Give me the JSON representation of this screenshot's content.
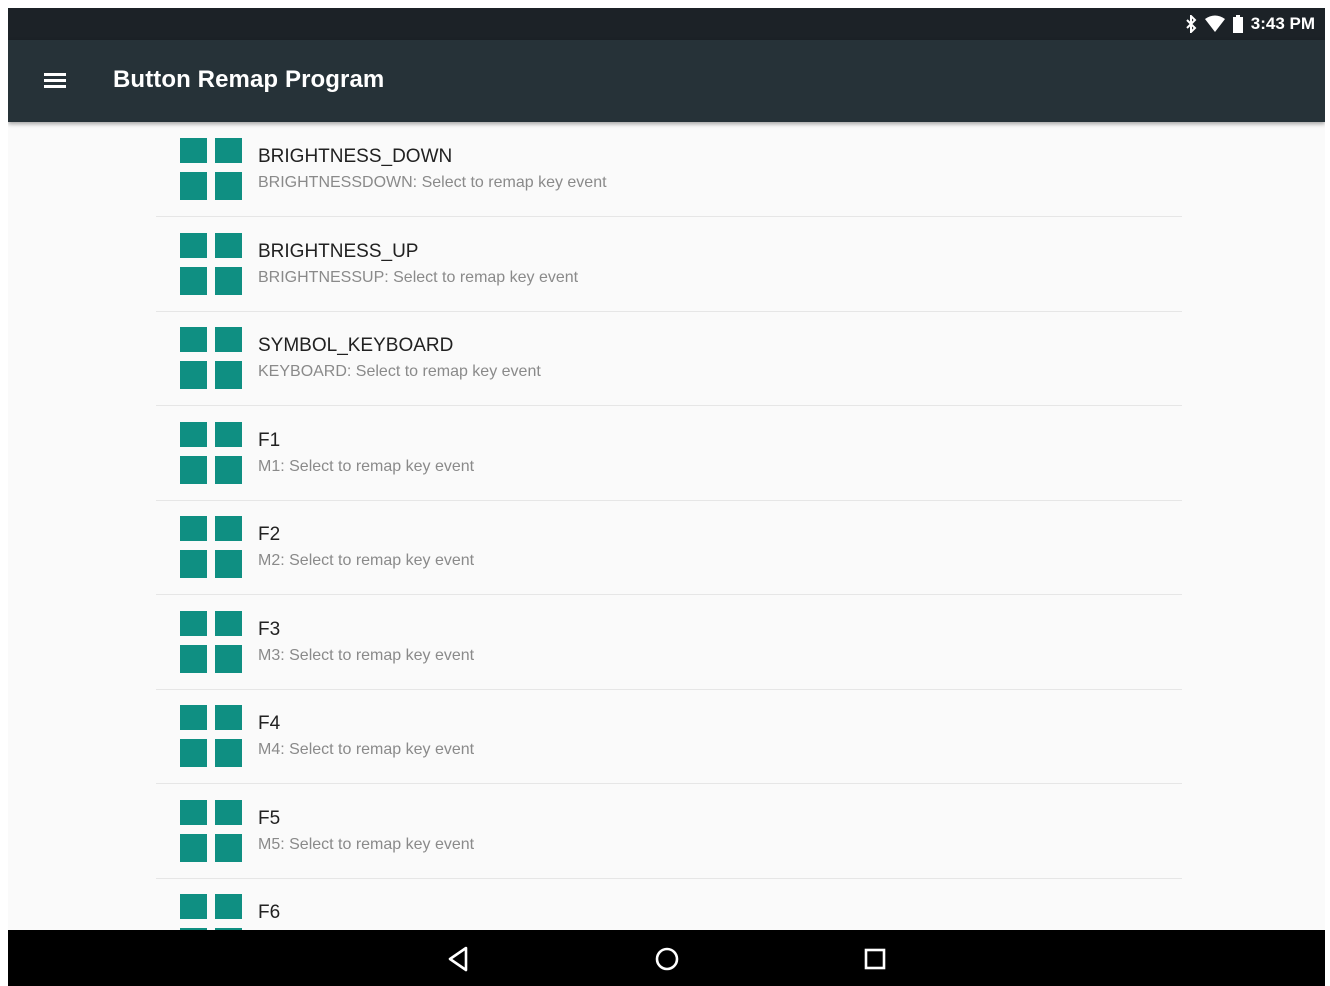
{
  "status_bar": {
    "time": "3:43 PM",
    "icons": [
      "bluetooth-icon",
      "wifi-icon",
      "battery-icon"
    ]
  },
  "app_bar": {
    "menu_icon": "hamburger-menu-icon",
    "title": "Button Remap Program"
  },
  "colors": {
    "status_bar": "#1c2227",
    "app_bar": "#263238",
    "icon_teal": "#0f8f82",
    "background": "#fafafa",
    "nav_bar": "#000000"
  },
  "list": {
    "items": [
      {
        "title": "BRIGHTNESS_DOWN",
        "subtitle": "BRIGHTNESSDOWN: Select to remap key event",
        "icon": "grid-app-icon"
      },
      {
        "title": "BRIGHTNESS_UP",
        "subtitle": "BRIGHTNESSUP: Select to remap key event",
        "icon": "grid-app-icon"
      },
      {
        "title": "SYMBOL_KEYBOARD",
        "subtitle": "KEYBOARD: Select to remap key event",
        "icon": "grid-app-icon"
      },
      {
        "title": "F1",
        "subtitle": "M1: Select to remap key event",
        "icon": "grid-app-icon"
      },
      {
        "title": "F2",
        "subtitle": "M2: Select to remap key event",
        "icon": "grid-app-icon"
      },
      {
        "title": "F3",
        "subtitle": "M3: Select to remap key event",
        "icon": "grid-app-icon"
      },
      {
        "title": "F4",
        "subtitle": "M4: Select to remap key event",
        "icon": "grid-app-icon"
      },
      {
        "title": "F5",
        "subtitle": "M5: Select to remap key event",
        "icon": "grid-app-icon"
      },
      {
        "title": "F6",
        "subtitle": "",
        "icon": "grid-app-icon"
      }
    ]
  },
  "nav_bar": {
    "buttons": [
      "back-icon",
      "home-icon",
      "recents-icon"
    ]
  }
}
